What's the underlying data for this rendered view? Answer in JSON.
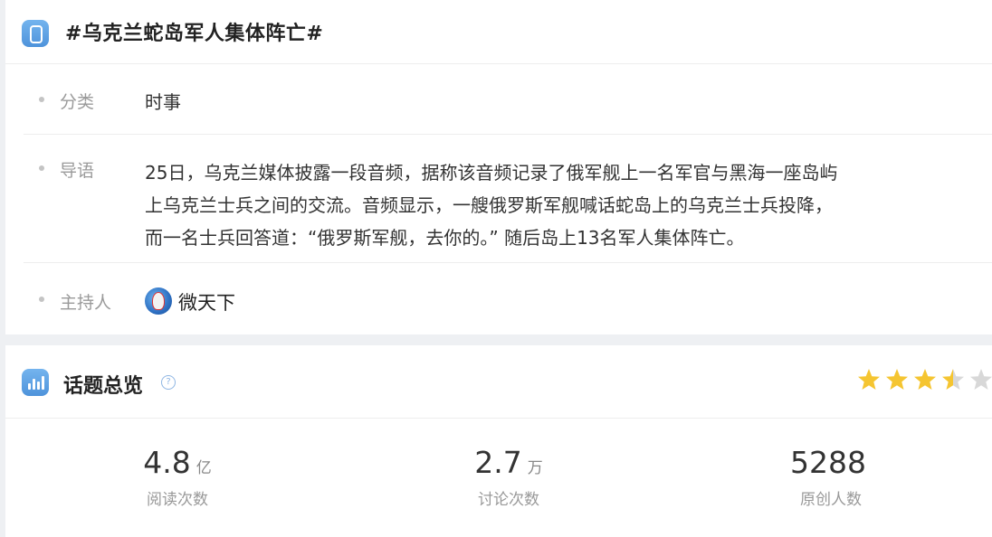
{
  "topic": {
    "title": "#乌克兰蛇岛军人集体阵亡#"
  },
  "info": {
    "category_label": "分类",
    "category_value": "时事",
    "intro_label": "导语",
    "intro_lines": [
      "25日，乌克兰媒体披露一段音频，据称该音频记录了俄军舰上一名军官与黑海一座岛屿",
      "上乌克兰士兵之间的交流。音频显示，一艘俄罗斯军舰喊话蛇岛上的乌克兰士兵投降，",
      "而一名士兵回答道：“俄罗斯军舰，去你的。” 随后岛上13名军人集体阵亡。"
    ],
    "host_label": "主持人",
    "host_name": "微天下"
  },
  "overview": {
    "title": "话题总览",
    "help_glyph": "?",
    "rating": 3.5,
    "rating_max": 5,
    "star_color_on": "#f5c531",
    "star_color_off": "#d8d8d8",
    "stats": [
      {
        "value": "4.8",
        "unit": "亿",
        "label": "阅读次数"
      },
      {
        "value": "2.7",
        "unit": "万",
        "label": "讨论次数"
      },
      {
        "value": "5288",
        "unit": "",
        "label": "原创人数"
      }
    ]
  },
  "icons": {
    "topic_badge": "topic-hash-icon",
    "overview_badge": "chart-bars-icon",
    "help": "help-circle-icon",
    "host_avatar": "avatar"
  }
}
